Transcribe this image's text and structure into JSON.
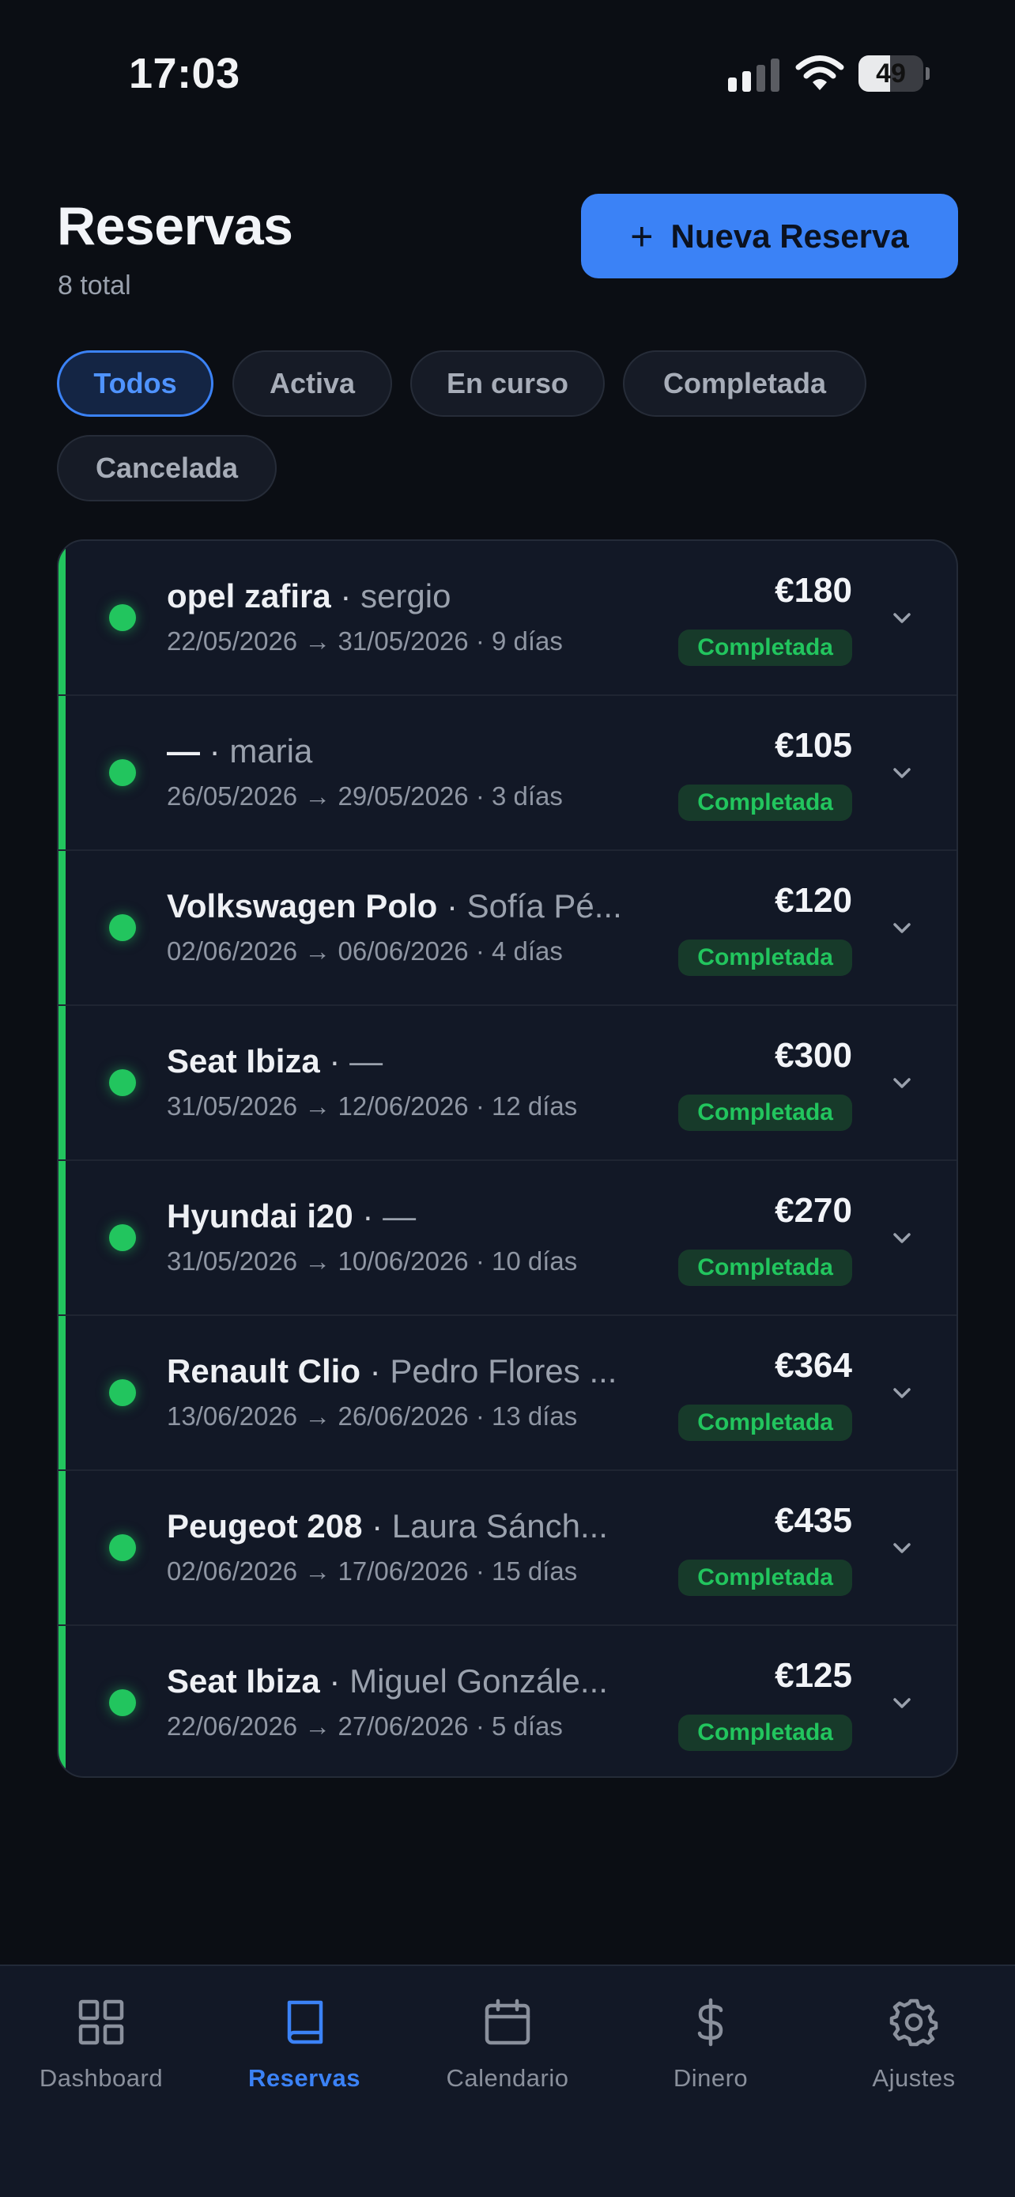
{
  "status": {
    "time": "17:03",
    "battery": "49",
    "battery_level": 49
  },
  "header": {
    "title": "Reservas",
    "subtitle": "8 total",
    "new_button_label": "Nueva Reserva"
  },
  "filters": [
    {
      "label": "Todos",
      "active": true
    },
    {
      "label": "Activa",
      "active": false
    },
    {
      "label": "En curso",
      "active": false
    },
    {
      "label": "Completada",
      "active": false
    },
    {
      "label": "Cancelada",
      "active": false
    }
  ],
  "reservations": [
    {
      "car": "opel zafira",
      "client": "sergio",
      "dates": "22/05/2026 → 31/05/2026 · 9 días",
      "price": "€180",
      "status": "Completada"
    },
    {
      "car": "—",
      "client": "maria",
      "dates": "26/05/2026 → 29/05/2026 · 3 días",
      "price": "€105",
      "status": "Completada"
    },
    {
      "car": "Volkswagen Polo",
      "client": "Sofía Pé...",
      "dates": "02/06/2026 → 06/06/2026 · 4 días",
      "price": "€120",
      "status": "Completada"
    },
    {
      "car": "Seat Ibiza",
      "client": "—",
      "dates": "31/05/2026 → 12/06/2026 · 12 días",
      "price": "€300",
      "status": "Completada"
    },
    {
      "car": "Hyundai i20",
      "client": "—",
      "dates": "31/05/2026 → 10/06/2026 · 10 días",
      "price": "€270",
      "status": "Completada"
    },
    {
      "car": "Renault Clio",
      "client": "Pedro Flores ...",
      "dates": "13/06/2026 → 26/06/2026 · 13 días",
      "price": "€364",
      "status": "Completada"
    },
    {
      "car": "Peugeot 208",
      "client": "Laura Sánch...",
      "dates": "02/06/2026 → 17/06/2026 · 15 días",
      "price": "€435",
      "status": "Completada"
    },
    {
      "car": "Seat Ibiza",
      "client": "Miguel Gonzále...",
      "dates": "22/06/2026 → 27/06/2026 · 5 días",
      "price": "€125",
      "status": "Completada"
    }
  ],
  "nav": [
    {
      "label": "Dashboard",
      "icon": "grid-icon",
      "active": false
    },
    {
      "label": "Reservas",
      "icon": "book-icon",
      "active": true
    },
    {
      "label": "Calendario",
      "icon": "calendar-icon",
      "active": false
    },
    {
      "label": "Dinero",
      "icon": "dollar-icon",
      "active": false
    },
    {
      "label": "Ajustes",
      "icon": "gear-icon",
      "active": false
    }
  ],
  "colors": {
    "accent": "#3b82f6",
    "success": "#22c55e",
    "background": "#0b0e14",
    "card": "#121826"
  }
}
